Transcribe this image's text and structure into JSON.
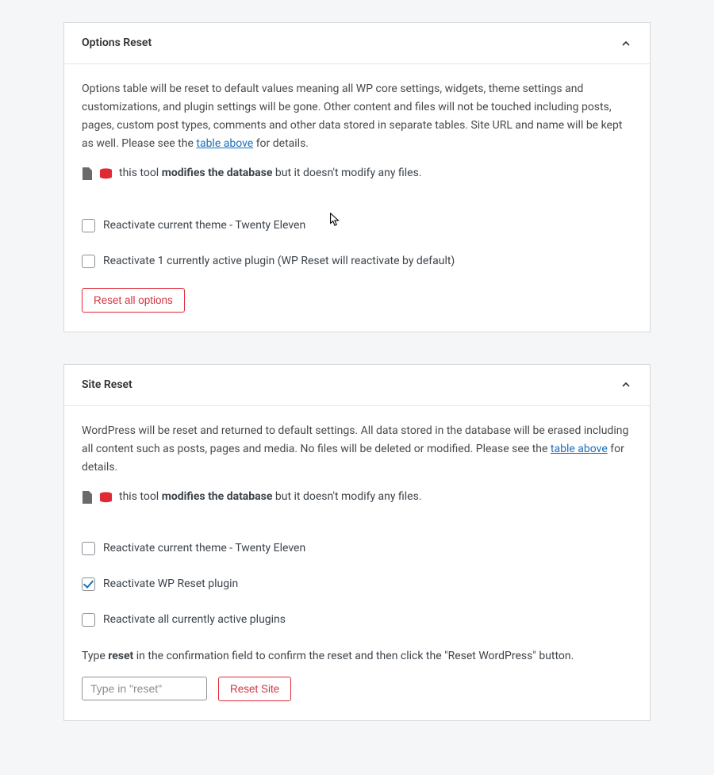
{
  "panel1": {
    "title": "Options Reset",
    "desc_before": "Options table will be reset to default values meaning all WP core settings, widgets, theme settings and customizations, and plugin settings will be gone. Other content and files will not be touched including posts, pages, custom post types, comments and other data stored in separate tables. Site URL and name will be kept as well. Please see the ",
    "desc_link": "table above",
    "desc_after": " for details.",
    "tool_prefix": "this tool ",
    "tool_strong": "modifies the database",
    "tool_suffix": " but it doesn't modify any files.",
    "checkboxes": [
      {
        "label": "Reactivate current theme - Twenty Eleven",
        "checked": false
      },
      {
        "label": "Reactivate 1 currently active plugin (WP Reset will reactivate by default)",
        "checked": false
      }
    ],
    "button": "Reset all options"
  },
  "panel2": {
    "title": "Site Reset",
    "desc_before": "WordPress will be reset and returned to default settings. All data stored in the database will be erased including all content such as posts, pages and media. No files will be deleted or modified. Please see the ",
    "desc_link": "table above",
    "desc_after": " for details.",
    "tool_prefix": "this tool ",
    "tool_strong": "modifies the database",
    "tool_suffix": " but it doesn't modify any files.",
    "checkboxes": [
      {
        "label": "Reactivate current theme - Twenty Eleven",
        "checked": false
      },
      {
        "label": "Reactivate WP Reset plugin",
        "checked": true
      },
      {
        "label": "Reactivate all currently active plugins",
        "checked": false
      }
    ],
    "confirm_before": "Type ",
    "confirm_strong": "reset",
    "confirm_after": " in the confirmation field to confirm the reset and then click the \"Reset WordPress\" button.",
    "input_placeholder": "Type in \"reset\"",
    "button": "Reset Site"
  }
}
